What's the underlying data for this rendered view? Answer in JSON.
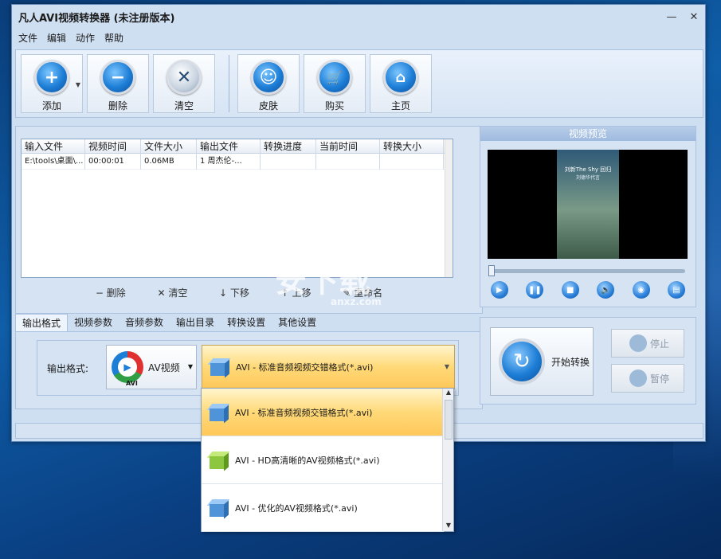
{
  "window": {
    "title": "凡人AVI视频转换器  (未注册版本)"
  },
  "menu": [
    "文件",
    "编辑",
    "动作",
    "帮助"
  ],
  "toolbar": {
    "add": "添加",
    "delete": "删除",
    "clear": "清空",
    "skin": "皮肤",
    "buy": "购买",
    "home": "主页"
  },
  "file_list": {
    "columns": [
      "输入文件",
      "视频时间",
      "文件大小",
      "输出文件",
      "转换进度",
      "当前时间",
      "转换大小"
    ],
    "rows": [
      {
        "input": "E:\\tools\\桌面\\...",
        "duration": "00:00:01",
        "size": "0.06MB",
        "output": "1 周杰伦-...",
        "progress": "",
        "current": "",
        "converted": ""
      }
    ],
    "actions": {
      "delete": "删除",
      "clear": "清空",
      "down": "下移",
      "up": "上移",
      "rename": "重命名"
    }
  },
  "preview": {
    "title": "视频预览",
    "overlay_line1": "刘新The Shy 回归",
    "overlay_line2": "刘德华代言"
  },
  "tabs": [
    "输出格式",
    "视频参数",
    "音频参数",
    "输出目录",
    "转换设置",
    "其他设置"
  ],
  "format": {
    "label": "输出格式:",
    "type_label": "AV视频",
    "type_badge": "AVI",
    "selected": "AVI - 标准音频视频交错格式(*.avi)"
  },
  "dropdown_options": [
    "AVI - 标准音频视频交错格式(*.avi)",
    "AVI - HD高清晰的AV视频格式(*.avi)",
    "AVI - 优化的AV视频格式(*.avi)"
  ],
  "convert": {
    "start": "开始转换",
    "stop": "停止",
    "pause": "暂停"
  },
  "watermark": {
    "text": "安下载",
    "sub": "anxz.com"
  }
}
